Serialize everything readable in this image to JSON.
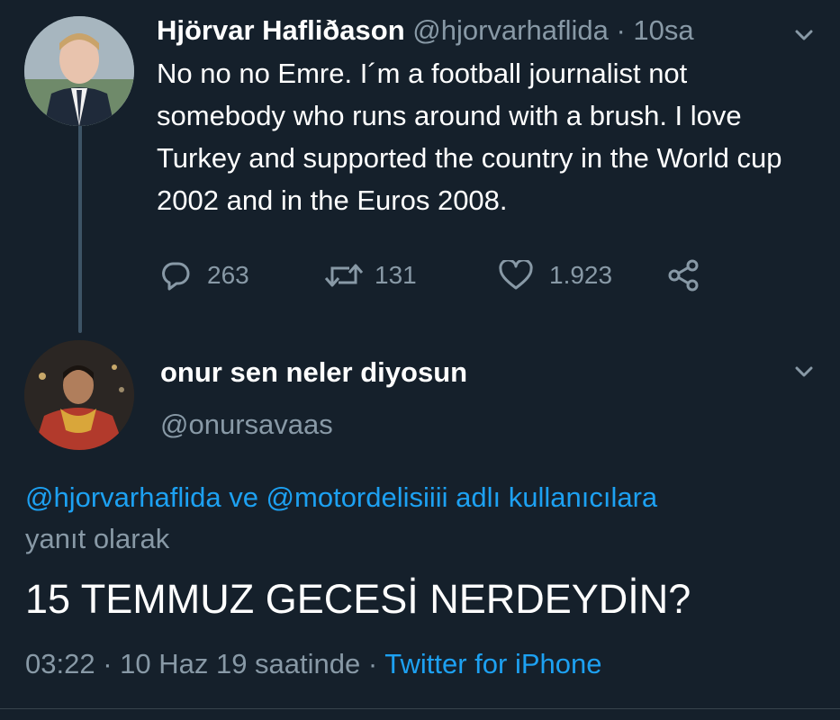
{
  "tweet1": {
    "author_name": "Hjörvar Hafliðason",
    "handle": "@hjorvarhaflida",
    "separator": "·",
    "time": "10sa",
    "text": "No no no Emre. I´m a football journalist not somebody who runs around with a brush. I love Turkey and supported the country in the World cup 2002 and in the Euros 2008.",
    "reply_count": "263",
    "retweet_count": "131",
    "like_count": "1.923"
  },
  "tweet2": {
    "author_name": "onur sen neler diyosun",
    "handle": "@onursavaas",
    "reply_to_users": "@hjorvarhaflida ve @motordelisiiii adlı kullanıcılara",
    "reply_to_suffix": "yanıt olarak",
    "text": "15 TEMMUZ GECESİ NERDEYDİN?",
    "timestamp": "03:22 · 10 Haz 19 saatinde",
    "dot": " · ",
    "source": "Twitter for iPhone"
  },
  "icons": {
    "reply": "reply-icon",
    "retweet": "retweet-icon",
    "like": "heart-icon",
    "share": "share-icon",
    "menu": "chevron-down-icon"
  },
  "colors": {
    "background": "#15202b",
    "text": "#ffffff",
    "muted": "#8899a6",
    "link": "#1da1f2"
  }
}
